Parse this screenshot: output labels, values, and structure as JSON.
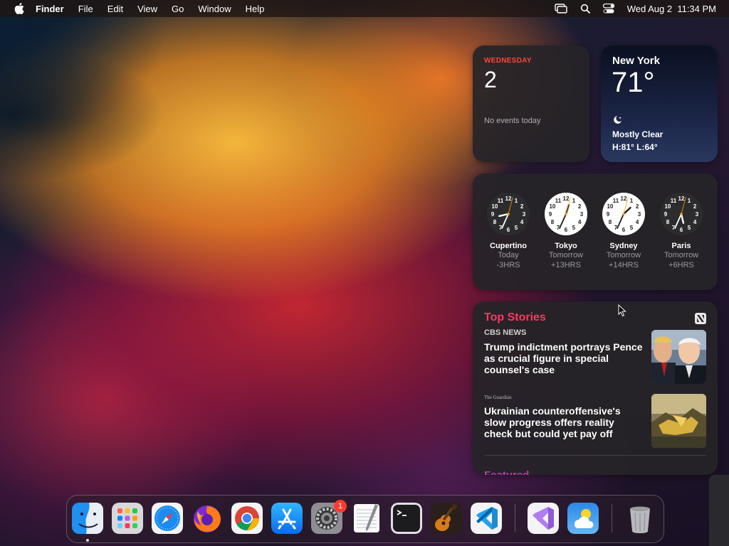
{
  "menubar": {
    "app_name": "Finder",
    "items": [
      "File",
      "Edit",
      "View",
      "Go",
      "Window",
      "Help"
    ],
    "datetime": "Wed Aug 2  11:34 PM",
    "icons": [
      "apple-icon",
      "screen-mirroring-icon",
      "search-icon",
      "control-center-icon"
    ]
  },
  "calendar_widget": {
    "weekday": "WEDNESDAY",
    "day": "2",
    "events_text": "No events today",
    "accent_color": "#ff453a"
  },
  "weather_widget": {
    "city": "New York",
    "temperature": "71°",
    "condition": "Mostly Clear",
    "high_low": "H:81° L:64°",
    "icon": "moon-icon"
  },
  "world_clock_widget": {
    "clocks": [
      {
        "city": "Cupertino",
        "day": "Today",
        "offset": "-3HRS",
        "theme": "dark",
        "time": "20:34"
      },
      {
        "city": "Tokyo",
        "day": "Tomorrow",
        "offset": "+13HRS",
        "theme": "light",
        "time": "12:34"
      },
      {
        "city": "Sydney",
        "day": "Tomorrow",
        "offset": "+14HRS",
        "theme": "light",
        "time": "13:34"
      },
      {
        "city": "Paris",
        "day": "Tomorrow",
        "offset": "+6HRS",
        "theme": "dark",
        "time": "05:34"
      }
    ]
  },
  "news_widget": {
    "section_title": "Top Stories",
    "accent_color": "#ff375f",
    "stories": [
      {
        "source": "CBS NEWS",
        "headline": "Trump indictment portrays Pence as crucial figure in special counsel's case"
      },
      {
        "source": "The Guardian",
        "headline": "Ukrainian counteroffensive's slow progress offers reality check but could yet pay off"
      }
    ],
    "next_section": "Featured"
  },
  "dock": {
    "apps": [
      "Finder",
      "Launchpad",
      "Safari",
      "Firefox",
      "Google Chrome",
      "App Store",
      "System Settings",
      "TextEdit",
      "Terminal",
      "GarageBand",
      "Visual Studio Code",
      "Visual Studio",
      "Weather",
      "Trash"
    ],
    "settings_badge": "1"
  }
}
